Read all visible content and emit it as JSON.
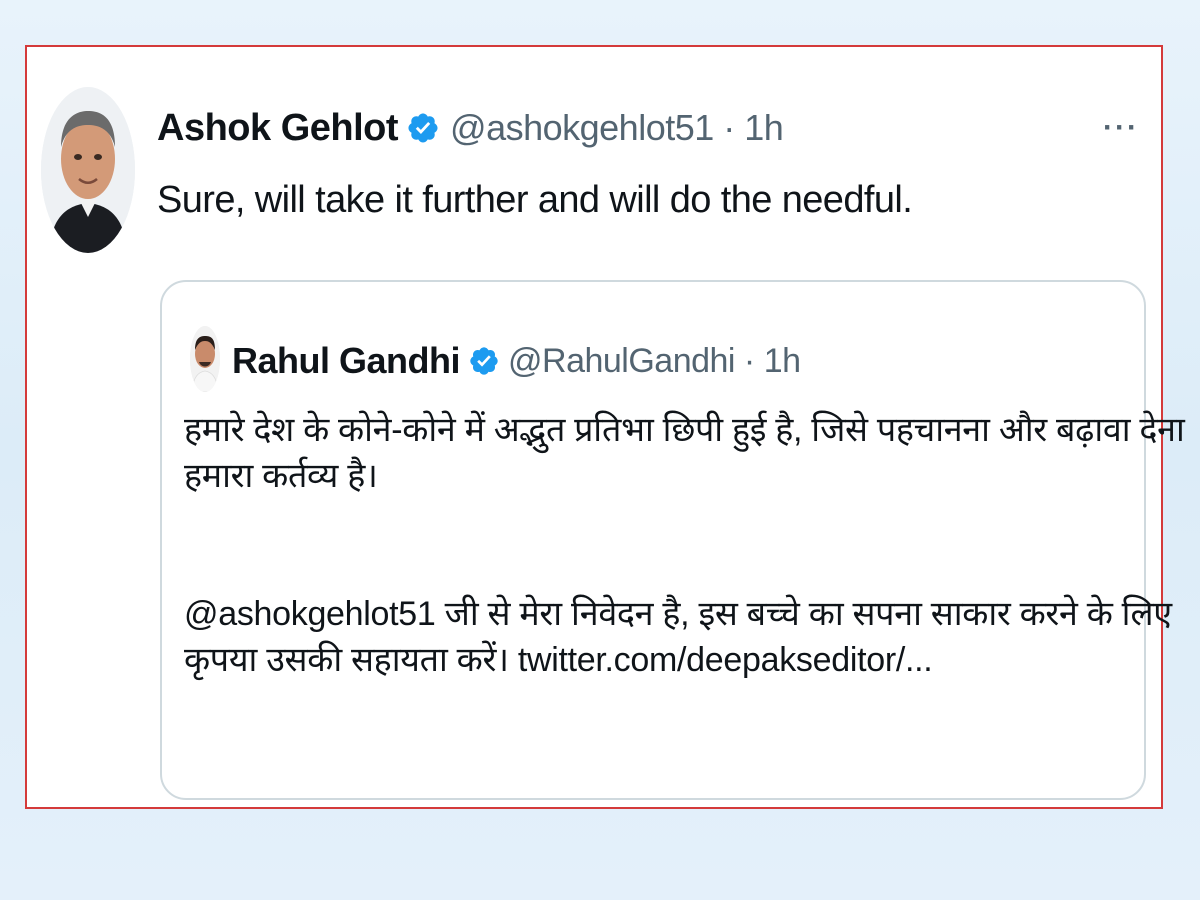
{
  "tweet": {
    "author_name": "Ashok Gehlot",
    "verified_icon": "verified-badge-icon",
    "handle_time": "@ashokgehlot51 · 1h",
    "more_label": "···",
    "text": "Sure, will take it further and will do the needful."
  },
  "quoted_tweet": {
    "author_name": "Rahul Gandhi",
    "verified_icon": "verified-badge-icon",
    "handle_time": "@RahulGandhi · 1h",
    "lines": [
      "हमारे देश के कोने-कोने में अद्भुत प्रतिभा छिपी हुई है, जिसे पहचानना और बढ़ावा देना",
      "हमारा कर्तव्य है।",
      "@ashokgehlot51 जी से मेरा निवेदन है, इस बच्चे का सपना साकार करने के लिए",
      "कृपया उसकी सहायता करें। twitter.com/deepakseditor/..."
    ]
  },
  "colors": {
    "frame_border": "#d43a3a",
    "verified_blue": "#1d9bf0",
    "secondary_text": "#536471",
    "quote_border": "#cfd9de"
  }
}
